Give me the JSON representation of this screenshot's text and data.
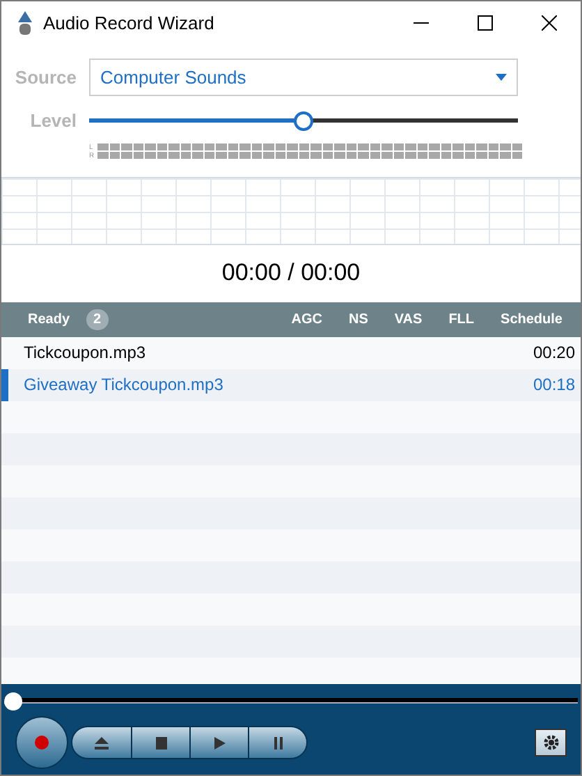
{
  "window": {
    "title": "Audio Record Wizard"
  },
  "source": {
    "label": "Source",
    "value": "Computer Sounds"
  },
  "level": {
    "label": "Level",
    "level": 0.5
  },
  "meter": {
    "channels": [
      "L",
      "R"
    ]
  },
  "time": "00:00 / 00:00",
  "list_header": {
    "status": "Ready",
    "count": "2",
    "columns": [
      "AGC",
      "NS",
      "VAS",
      "FLL",
      "Schedule"
    ]
  },
  "files": [
    {
      "name": "Tickcoupon.mp3",
      "duration": "00:20",
      "selected": false
    },
    {
      "name": "Giveaway Tickcoupon.mp3",
      "duration": "00:18",
      "selected": true
    }
  ],
  "seek": {
    "level": 0
  }
}
